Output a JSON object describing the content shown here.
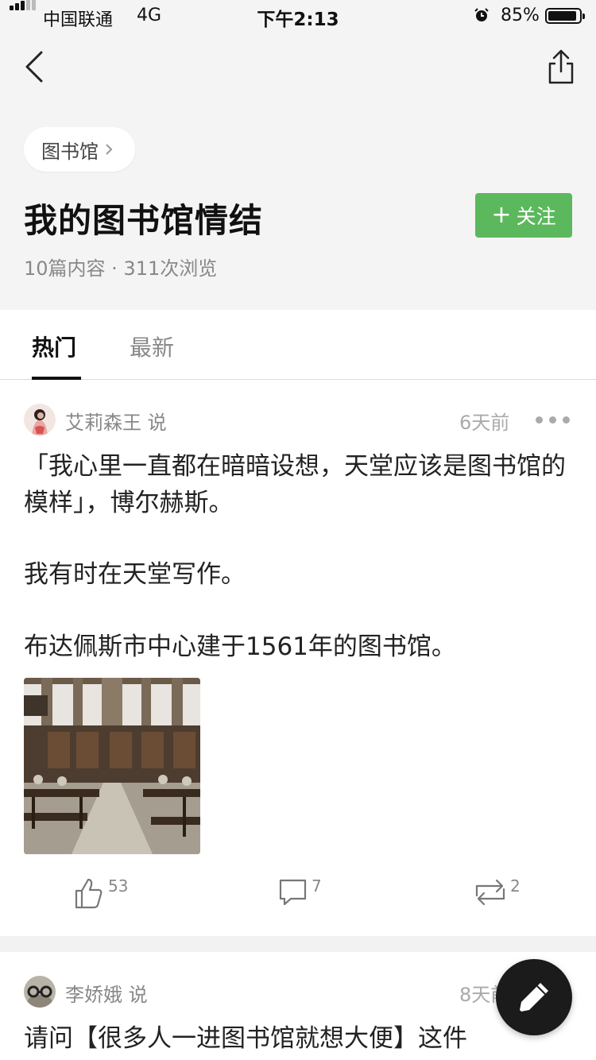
{
  "status_bar": {
    "carrier": "中国联通",
    "network": "4G",
    "time": "下午2:13",
    "battery": "85%"
  },
  "topic": {
    "category_chip": "图书馆",
    "title": "我的图书馆情结",
    "follow_label": "关注",
    "stats": "10篇内容 · 311次浏览"
  },
  "tabs": [
    {
      "label": "热门",
      "active": true
    },
    {
      "label": "最新",
      "active": false
    }
  ],
  "posts": [
    {
      "author": "艾莉森王 说",
      "time_ago": "6天前",
      "paragraphs": [
        "「我心里一直都在暗暗设想，天堂应该是图书馆的模样」，博尔赫斯。",
        "我有时在天堂写作。",
        "布达佩斯市中心建于1561年的图书馆。"
      ],
      "likes": "53",
      "comments": "7",
      "reposts": "2"
    },
    {
      "author": "李娇娥 说",
      "time_ago": "8天前",
      "text": "请问【很多人一进图书馆就想大便】这件"
    }
  ],
  "icons": {
    "back": "chevron-left-icon",
    "share": "share-icon",
    "like": "thumbs-up-icon",
    "comment": "comment-icon",
    "repost": "repost-icon",
    "more": "more-dots-icon",
    "compose": "pencil-icon"
  },
  "colors": {
    "accent_green": "#5cb85c",
    "header_bg": "#f4f4f4",
    "fab_bg": "#1b1b1b"
  }
}
